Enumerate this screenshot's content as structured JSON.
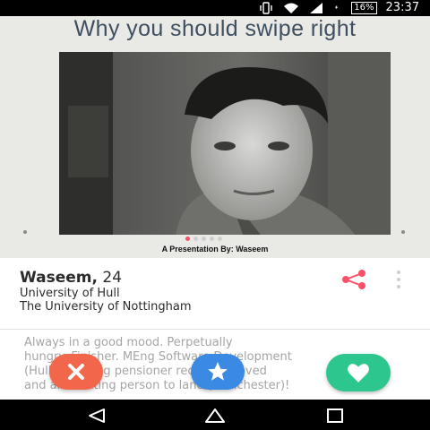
{
  "status_bar": {
    "battery": "16%",
    "time": "23:37",
    "icons": [
      "vibrate-icon",
      "wifi-icon",
      "signal-icon",
      "charging-icon"
    ]
  },
  "slide": {
    "title": "Why you should swipe right",
    "footer": "A Presentation By: Waseem",
    "dots_count": 5,
    "active_dot": 0
  },
  "profile": {
    "name": "Waseem,",
    "age": "24",
    "school_1": "University of Hull",
    "school_2": "The University of Nottingham",
    "share_icon": "share-icon",
    "more_icon": "more-vertical-icon"
  },
  "bio": {
    "line1": "Always in a good mood. Perpetually",
    "line2": "hungry. Finisher. MEng Software Development",
    "line3": "(Hull). Aspiring pensioner recently moved",
    "line4": "and am floating person to land (Manchester)!"
  },
  "actions": {
    "nope_icon": "close-icon",
    "superlike_icon": "star-icon",
    "like_icon": "heart-icon"
  },
  "colors": {
    "accent": "#fd5068",
    "nope": "#f2674c",
    "superlike": "#3a8ae4",
    "like": "#2ec68f",
    "title": "#3e4f5f"
  },
  "nav": {
    "back_icon": "back-triangle-icon",
    "home_icon": "home-icon",
    "recents_icon": "recents-square-icon"
  }
}
